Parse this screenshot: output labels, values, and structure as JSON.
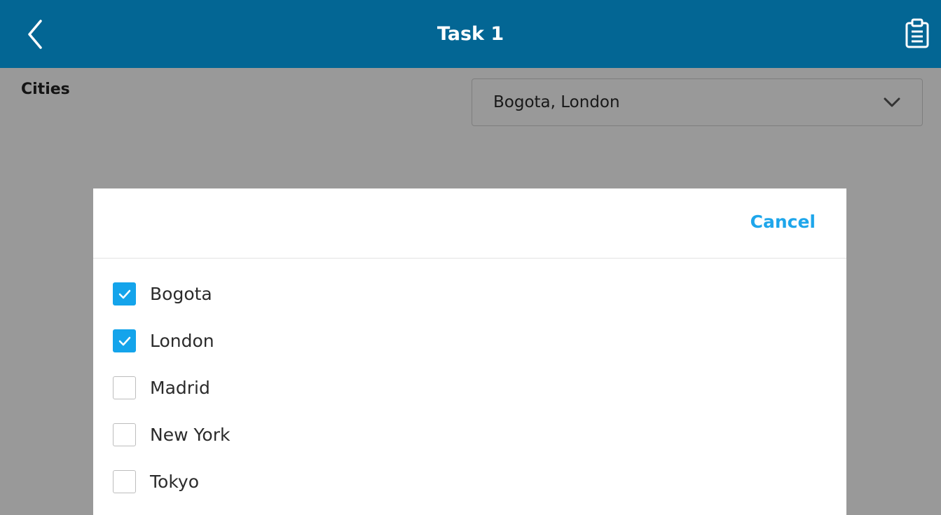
{
  "header": {
    "title": "Task 1",
    "back_icon": "chevron-left-icon",
    "action_icon": "clipboard-icon",
    "background": "#036694"
  },
  "form": {
    "field_label": "Cities",
    "select_value": "Bogota, London",
    "select_icon": "chevron-down-icon"
  },
  "dialog": {
    "cancel_label": "Cancel",
    "accent": "#14a4eb",
    "options": [
      {
        "label": "Bogota",
        "checked": true
      },
      {
        "label": "London",
        "checked": true
      },
      {
        "label": "Madrid",
        "checked": false
      },
      {
        "label": "New York",
        "checked": false
      },
      {
        "label": "Tokyo",
        "checked": false
      }
    ]
  }
}
